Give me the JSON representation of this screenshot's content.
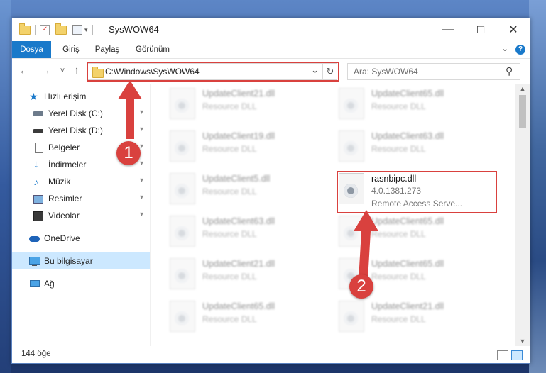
{
  "window": {
    "title": "SysWOW64",
    "controls": {
      "minimize": "—",
      "maximize": "☐",
      "close": "✕"
    }
  },
  "ribbon": {
    "tabs": [
      {
        "label": "Dosya"
      },
      {
        "label": "Giriş"
      },
      {
        "label": "Paylaş"
      },
      {
        "label": "Görünüm"
      }
    ],
    "expand_icon": "⌄",
    "help_icon": "?"
  },
  "nav": {
    "address": "C:\\Windows\\SysWOW64",
    "search_placeholder": "Ara: SysWOW64",
    "back_icon": "←",
    "forward_icon": "→",
    "recent_icon": "˅",
    "up_icon": "↑",
    "dropdown_icon": "⌄",
    "refresh_icon": "↻",
    "search_icon": "⚲"
  },
  "sidebar": {
    "quick_access": "Hızlı erişim",
    "items": [
      {
        "label": "Yerel Disk (C:)"
      },
      {
        "label": "Yerel Disk (D:)"
      },
      {
        "label": "Belgeler"
      },
      {
        "label": "İndirmeler"
      },
      {
        "label": "Müzik"
      },
      {
        "label": "Resimler"
      },
      {
        "label": "Videolar"
      }
    ],
    "onedrive": "OneDrive",
    "this_pc": "Bu bilgisayar",
    "network": "Ağ",
    "pin_icon": "📌"
  },
  "files": {
    "left": [
      {
        "name": "UpdateClient21.dll",
        "desc": "Resource DLL"
      },
      {
        "name": "UpdateClient19.dll",
        "desc": "Resource DLL"
      },
      {
        "name": "UpdateClient5.dll",
        "desc": "Resource DLL"
      },
      {
        "name": "UpdateClient63.dll",
        "desc": "Resource DLL"
      },
      {
        "name": "UpdateClient21.dll",
        "desc": "Resource DLL"
      },
      {
        "name": "UpdateClient65.dll",
        "desc": "Resource DLL"
      }
    ],
    "right": [
      {
        "name": "UpdateClient65.dll",
        "desc": "Resource DLL"
      },
      {
        "name": "UpdateClient63.dll",
        "desc": "Resource DLL"
      },
      {
        "name": "UpdateClient65.dll",
        "desc": "Resource DLL"
      },
      {
        "name": "UpdateClient65.dll",
        "desc": "Resource DLL"
      },
      {
        "name": "UpdateClient21.dll",
        "desc": "Resource DLL"
      }
    ],
    "highlighted": {
      "name": "rasnbipc.dll",
      "version": "4.0.1381.273",
      "desc": "Remote Access Serve..."
    }
  },
  "status": {
    "count": "144 öğe"
  },
  "annotations": {
    "badge1": "1",
    "badge2": "2",
    "color": "#d9413e"
  }
}
